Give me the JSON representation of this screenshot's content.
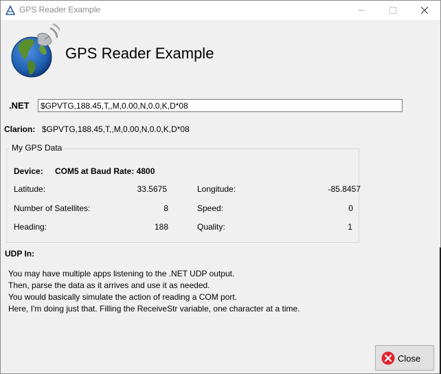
{
  "window": {
    "title": "GPS Reader Example",
    "minimize_icon": "minimize-icon",
    "maximize_icon": "maximize-icon",
    "close_icon": "close-icon"
  },
  "header": {
    "title": "GPS Reader Example",
    "logo_icon": "globe-satellite-icon"
  },
  "net": {
    "label": ".NET",
    "value": "$GPVTG,188.45,T,,M,0.00,N,0.0,K,D*08"
  },
  "clarion": {
    "label": "Clarion:",
    "value": "$GPVTG,188.45,T,,M,0.00,N,0.0,K,D*08"
  },
  "gps_group": {
    "title": "My GPS Data",
    "device_label": "Device:",
    "device_value": "COM5 at Baud Rate: 4800",
    "latitude_label": "Latitude:",
    "latitude_value": "33.5675",
    "longitude_label": "Longitude:",
    "longitude_value": "-85.8457",
    "satellites_label": "Number of Satellites:",
    "satellites_value": "8",
    "speed_label": "Speed:",
    "speed_value": "0",
    "heading_label": "Heading:",
    "heading_value": "188",
    "quality_label": "Quality:",
    "quality_value": "1"
  },
  "udp": {
    "label": "UDP In:",
    "lines": [
      "You may have multiple apps listening to the .NET UDP output.",
      "Then, parse the data as it arrives and use it as needed.",
      "You would basically simulate the action of reading a COM port.",
      "Here, I'm doing just that.  Filling the ReceiveStr variable, one character at a time."
    ]
  },
  "buttons": {
    "close_label": "Close",
    "close_icon": "close-circle-icon"
  },
  "colors": {
    "window_bg": "#f0f0f0",
    "close_icon_red": "#e0242f",
    "globe_ocean": "#1f5fb0",
    "globe_land": "#5a8f2a"
  }
}
